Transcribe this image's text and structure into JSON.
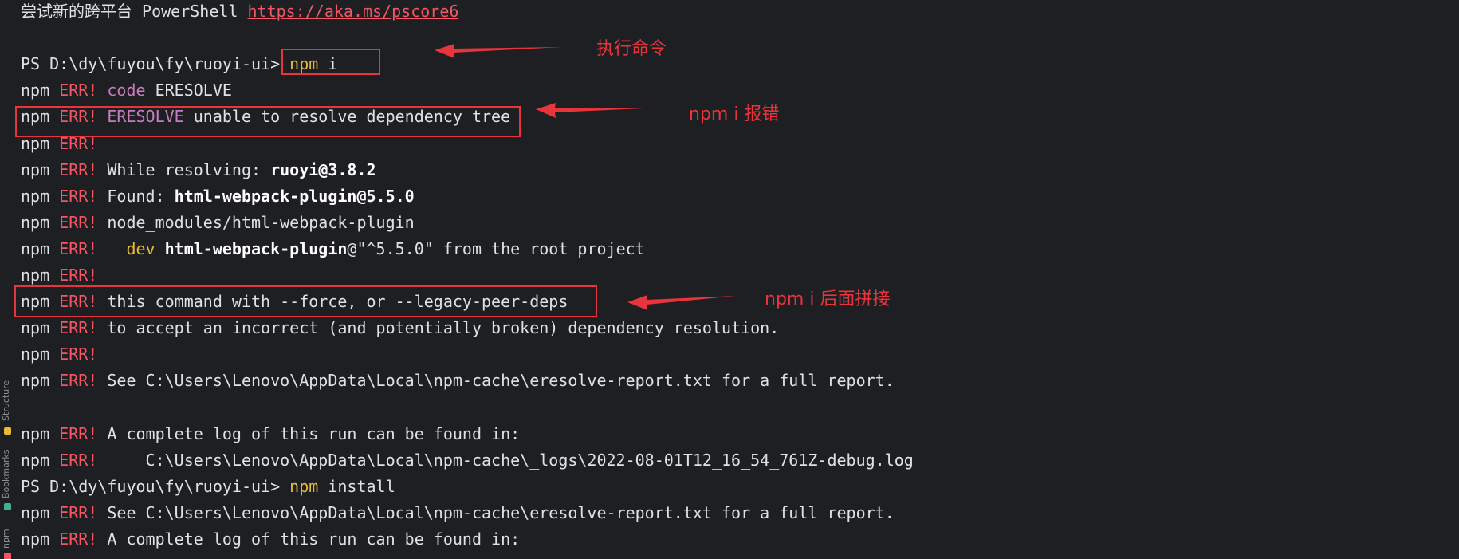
{
  "terminal": {
    "lines": [
      [
        {
          "t": "尝试新的跨平台 PowerShell ",
          "c": "plain"
        },
        {
          "t": "https://aka.ms/pscore6",
          "c": "link"
        }
      ],
      [],
      [
        {
          "t": "PS D:\\dy\\fuyou\\fy\\ruoyi-ui> ",
          "c": "plain"
        },
        {
          "t": "npm",
          "c": "cmd"
        },
        {
          "t": " i",
          "c": "plain"
        }
      ],
      [
        {
          "t": "npm ",
          "c": "plain"
        },
        {
          "t": "ERR!",
          "c": "err"
        },
        {
          "t": " ",
          "c": "plain"
        },
        {
          "t": "code",
          "c": "code"
        },
        {
          "t": " ERESOLVE",
          "c": "plain"
        }
      ],
      [
        {
          "t": "npm ",
          "c": "plain"
        },
        {
          "t": "ERR!",
          "c": "err"
        },
        {
          "t": " ",
          "c": "plain"
        },
        {
          "t": "ERESOLVE",
          "c": "code"
        },
        {
          "t": " unable to resolve dependency tree",
          "c": "plain"
        }
      ],
      [
        {
          "t": "npm ",
          "c": "plain"
        },
        {
          "t": "ERR!",
          "c": "err"
        }
      ],
      [
        {
          "t": "npm ",
          "c": "plain"
        },
        {
          "t": "ERR!",
          "c": "err"
        },
        {
          "t": " While resolving: ",
          "c": "plain"
        },
        {
          "t": "ruoyi@3.8.2",
          "c": "bold"
        }
      ],
      [
        {
          "t": "npm ",
          "c": "plain"
        },
        {
          "t": "ERR!",
          "c": "err"
        },
        {
          "t": " Found: ",
          "c": "plain"
        },
        {
          "t": "html-webpack-plugin@5.5.0",
          "c": "bold"
        }
      ],
      [
        {
          "t": "npm ",
          "c": "plain"
        },
        {
          "t": "ERR!",
          "c": "err"
        },
        {
          "t": " node_modules/html-webpack-plugin",
          "c": "plain"
        }
      ],
      [
        {
          "t": "npm ",
          "c": "plain"
        },
        {
          "t": "ERR!",
          "c": "err"
        },
        {
          "t": "   ",
          "c": "plain"
        },
        {
          "t": "dev",
          "c": "dev"
        },
        {
          "t": " ",
          "c": "plain"
        },
        {
          "t": "html-webpack-plugin",
          "c": "bold"
        },
        {
          "t": "@\"^5.5.0\" from the root project",
          "c": "plain"
        }
      ],
      [
        {
          "t": "npm ",
          "c": "plain"
        },
        {
          "t": "ERR!",
          "c": "err"
        }
      ],
      [
        {
          "t": "npm ",
          "c": "plain"
        },
        {
          "t": "ERR!",
          "c": "err"
        },
        {
          "t": " this command with --force, or --legacy-peer-deps",
          "c": "plain"
        }
      ],
      [
        {
          "t": "npm ",
          "c": "plain"
        },
        {
          "t": "ERR!",
          "c": "err"
        },
        {
          "t": " to accept an incorrect (and potentially broken) dependency resolution.",
          "c": "plain"
        }
      ],
      [
        {
          "t": "npm ",
          "c": "plain"
        },
        {
          "t": "ERR!",
          "c": "err"
        }
      ],
      [
        {
          "t": "npm ",
          "c": "plain"
        },
        {
          "t": "ERR!",
          "c": "err"
        },
        {
          "t": " See C:\\Users\\Lenovo\\AppData\\Local\\npm-cache\\eresolve-report.txt for a full report.",
          "c": "plain"
        }
      ],
      [],
      [
        {
          "t": "npm ",
          "c": "plain"
        },
        {
          "t": "ERR!",
          "c": "err"
        },
        {
          "t": " A complete log of this run can be found in:",
          "c": "plain"
        }
      ],
      [
        {
          "t": "npm ",
          "c": "plain"
        },
        {
          "t": "ERR!",
          "c": "err"
        },
        {
          "t": "     C:\\Users\\Lenovo\\AppData\\Local\\npm-cache\\_logs\\2022-08-01T12_16_54_761Z-debug.log",
          "c": "plain"
        }
      ],
      [
        {
          "t": "PS D:\\dy\\fuyou\\fy\\ruoyi-ui> ",
          "c": "plain"
        },
        {
          "t": "npm",
          "c": "cmd"
        },
        {
          "t": " install",
          "c": "plain"
        }
      ],
      [
        {
          "t": "npm ",
          "c": "plain"
        },
        {
          "t": "ERR!",
          "c": "err"
        },
        {
          "t": " See C:\\Users\\Lenovo\\AppData\\Local\\npm-cache\\eresolve-report.txt for a full report.",
          "c": "plain"
        }
      ],
      [
        {
          "t": "npm ",
          "c": "plain"
        },
        {
          "t": "ERR!",
          "c": "err"
        },
        {
          "t": " A complete log of this run can be found in:",
          "c": "plain"
        }
      ]
    ]
  },
  "annotations": {
    "exec_command": "执行命令",
    "npm_i_error": "npm i 报错",
    "npm_i_append": "npm i 后面拼接"
  },
  "side_tabs": {
    "structure": "Structure",
    "bookmarks": "Bookmarks",
    "npm": "npm"
  },
  "colors": {
    "background": "#1e1f22",
    "text": "#dfe1e5",
    "error": "#f75464",
    "keyword": "#c77dbb",
    "command": "#e8ba36",
    "annotation": "#e8353c"
  }
}
